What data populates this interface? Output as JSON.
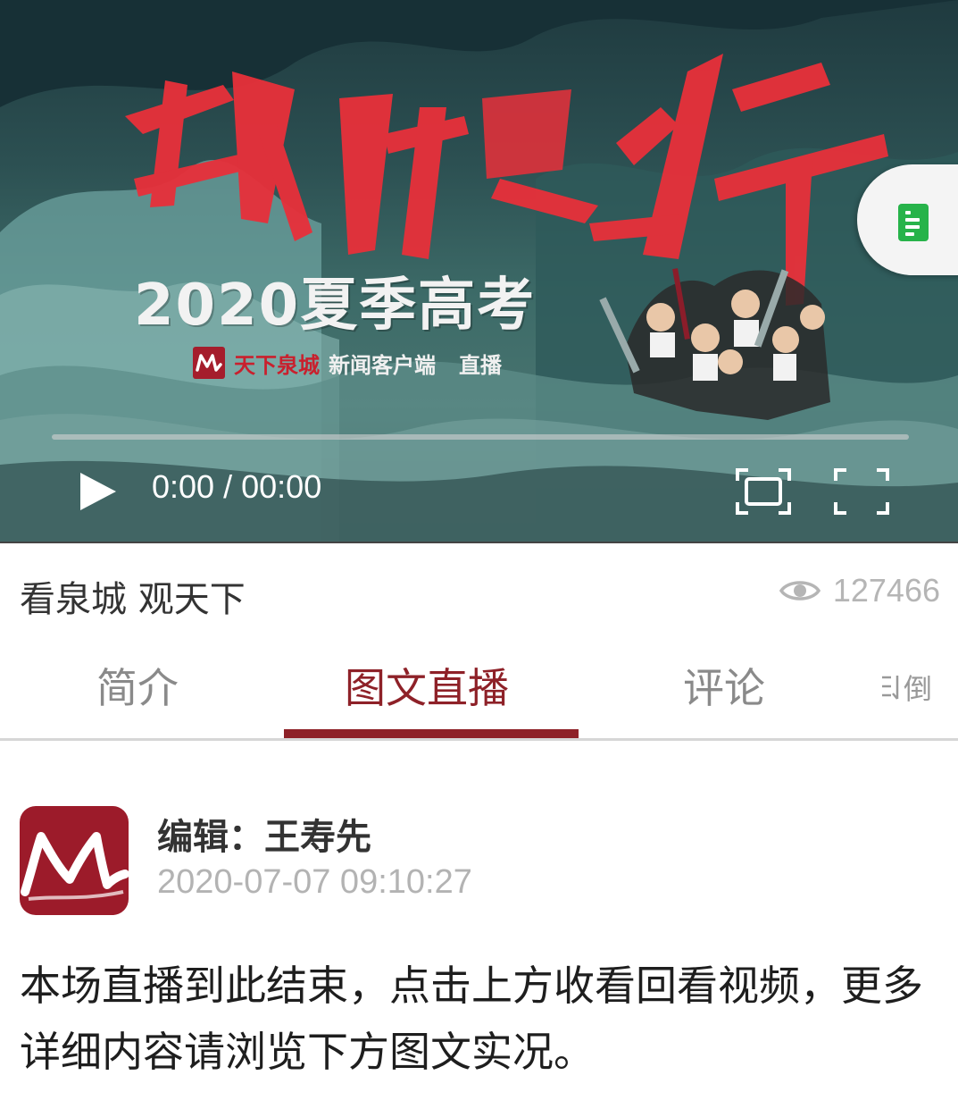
{
  "video": {
    "calligraphy_title": "乘风破浪吧少年",
    "headline": "2020夏季高考",
    "brand_name": "天下泉城",
    "brand_client": "新闻客户端",
    "brand_live": "直播",
    "current_time": "0:00",
    "separator": "/",
    "duration": "00:00",
    "progress": 0
  },
  "header": {
    "title": "看泉城 观天下",
    "view_count": "127466"
  },
  "tabs": [
    {
      "label": "简介"
    },
    {
      "label": "图文直播"
    },
    {
      "label": "评论"
    }
  ],
  "active_tab": 1,
  "sort_label": "倒",
  "post": {
    "editor": "编辑：王寿先",
    "timestamp": "2020-07-07 09:10:27",
    "content": "本场直播到此结束，点击上方收看回看视频，更多详细内容请浏览下方图文实况。"
  },
  "colors": {
    "accent": "#8e2128",
    "logo": "#9c1b2a",
    "calligraphy": "#e8303a",
    "doc_button": "#27b34a"
  },
  "icons": [
    "play-icon",
    "pip-icon",
    "fullscreen-icon",
    "eye-icon",
    "document-icon",
    "sort-icon"
  ]
}
